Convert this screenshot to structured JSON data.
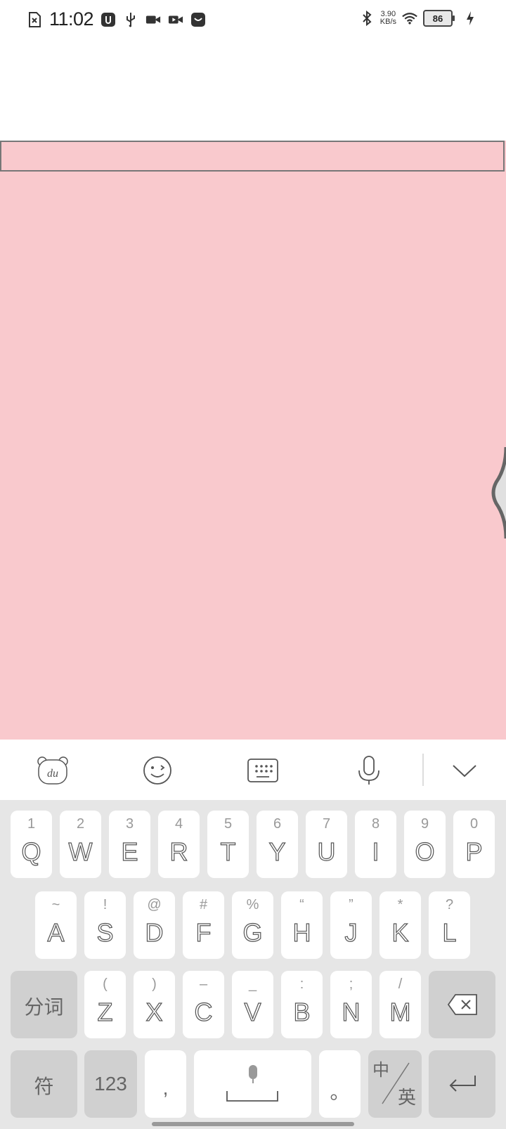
{
  "status_bar": {
    "time": "11:02",
    "net_speed_value": "3.90",
    "net_speed_unit": "KB/s",
    "battery": "86",
    "icons": [
      "sim-missing-icon",
      "usb-debug-icon",
      "usb-icon",
      "video-camera-icon",
      "video-record-icon",
      "app-notification-icon",
      "bluetooth-icon",
      "wifi-icon",
      "charging-icon"
    ]
  },
  "colors": {
    "panel_background": "#f9c9cd",
    "keyboard_background": "#e6e6e6",
    "function_key": "#d0d0d0"
  },
  "toolbar": {
    "icons": [
      "du-logo-icon",
      "emoji-icon",
      "keyboard-icon",
      "microphone-icon",
      "chevron-down-icon"
    ]
  },
  "keyboard": {
    "row1": [
      {
        "main": "Q",
        "sub": "1"
      },
      {
        "main": "W",
        "sub": "2"
      },
      {
        "main": "E",
        "sub": "3"
      },
      {
        "main": "R",
        "sub": "4"
      },
      {
        "main": "T",
        "sub": "5"
      },
      {
        "main": "Y",
        "sub": "6"
      },
      {
        "main": "U",
        "sub": "7"
      },
      {
        "main": "I",
        "sub": "8"
      },
      {
        "main": "O",
        "sub": "9"
      },
      {
        "main": "P",
        "sub": "0"
      }
    ],
    "row2": [
      {
        "main": "A",
        "sub": "~"
      },
      {
        "main": "S",
        "sub": "!"
      },
      {
        "main": "D",
        "sub": "@"
      },
      {
        "main": "F",
        "sub": "#"
      },
      {
        "main": "G",
        "sub": "%"
      },
      {
        "main": "H",
        "sub": "“"
      },
      {
        "main": "J",
        "sub": "”"
      },
      {
        "main": "K",
        "sub": "*"
      },
      {
        "main": "L",
        "sub": "?"
      }
    ],
    "row3": [
      {
        "main": "Z",
        "sub": "("
      },
      {
        "main": "X",
        "sub": ")"
      },
      {
        "main": "C",
        "sub": "–"
      },
      {
        "main": "V",
        "sub": "_"
      },
      {
        "main": "B",
        "sub": ":"
      },
      {
        "main": "N",
        "sub": ";"
      },
      {
        "main": "M",
        "sub": "/"
      }
    ],
    "segment_key": "分词",
    "symbol_key": "符",
    "number_key": "123",
    "comma_key": ",",
    "period_key": "。",
    "lang_key_top": "中",
    "lang_key_bottom": "英"
  }
}
